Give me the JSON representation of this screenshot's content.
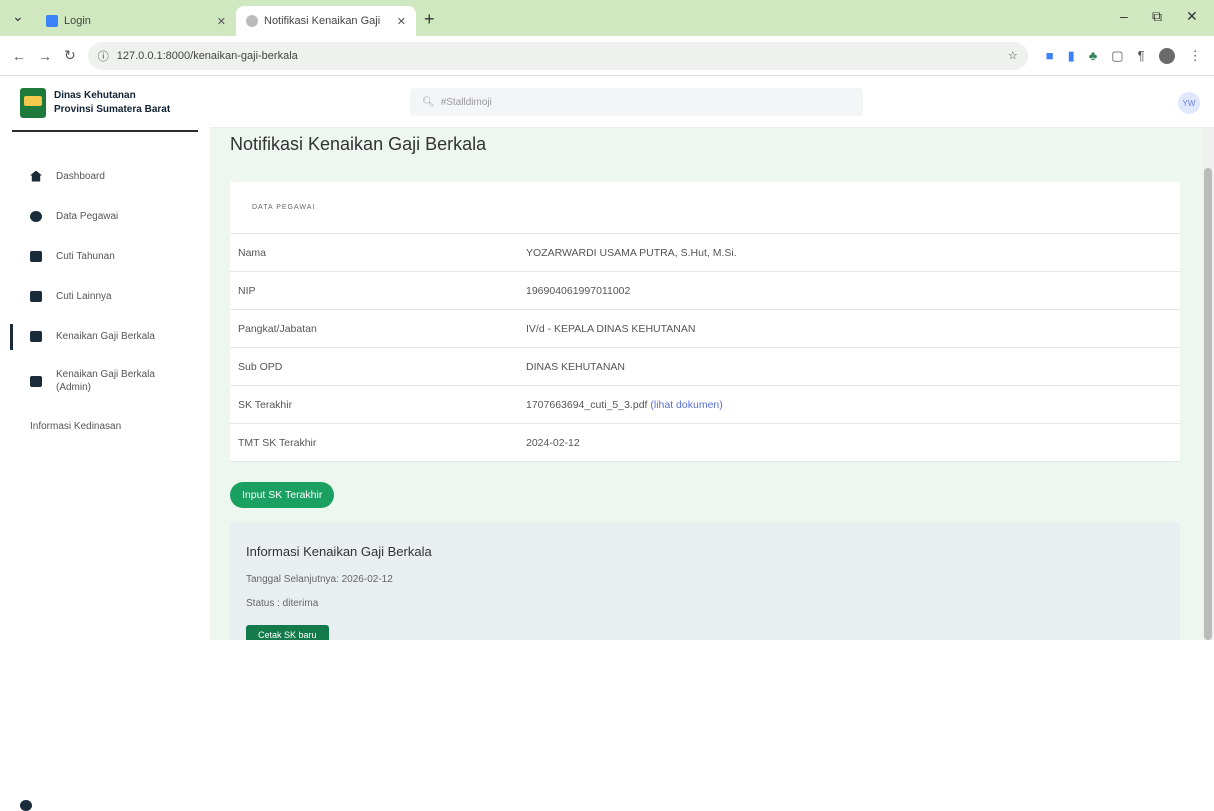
{
  "browser": {
    "tabs": [
      {
        "title": "Login",
        "active": false
      },
      {
        "title": "Notifikasi Kenaikan Gaji Berkala",
        "active": true
      }
    ],
    "new_tab": "+",
    "address": "127.0.0.1:8000/kenaikan-gaji-berkala",
    "controls": {
      "minimize": "–",
      "maximize": "⧉",
      "close": "✕"
    }
  },
  "brand": {
    "line1": "Dinas Kehutanan",
    "line2": "Provinsi Sumatera Barat"
  },
  "sidebar": {
    "items": [
      {
        "label": "Dashboard",
        "icon": "home-icon"
      },
      {
        "label": "Data Pegawai",
        "icon": "users-icon"
      },
      {
        "label": "Cuti Tahunan",
        "icon": "folder-icon"
      },
      {
        "label": "Cuti Lainnya",
        "icon": "folder-icon"
      },
      {
        "label": "Kenaikan Gaji Berkala",
        "icon": "card-icon",
        "active": true
      },
      {
        "label": "Kenaikan Gaji Berkala (Admin)",
        "icon": "card-icon"
      },
      {
        "label": "Informasi Kedinasan",
        "icon": "info-icon"
      }
    ]
  },
  "topbar": {
    "search_placeholder": "#Stalldimoji",
    "user_initials": "YW"
  },
  "page": {
    "title": "Notifikasi Kenaikan Gaji Berkala",
    "card_header": "DATA PEGAWAI",
    "rows": [
      {
        "key": "Nama",
        "value": "YOZARWARDI USAMA PUTRA, S.Hut, M.Si."
      },
      {
        "key": "NIP",
        "value": "196904061997011002"
      },
      {
        "key": "Pangkat/Jabatan",
        "value": "IV/d - KEPALA DINAS KEHUTANAN"
      },
      {
        "key": "Sub OPD",
        "value": "DINAS KEHUTANAN"
      },
      {
        "key": "SK Terakhir",
        "value": "1707663694_cuti_5_3.pdf",
        "link": "(lihat dokumen)"
      },
      {
        "key": "TMT SK Terakhir",
        "value": "2024-02-12"
      }
    ],
    "input_button": "Input SK Terakhir",
    "info": {
      "title": "Informasi Kenaikan Gaji Berkala",
      "next_date": "Tanggal Selanjutnya: 2026-02-12",
      "status": "Status : diterima",
      "button": "Cetak SK baru"
    }
  }
}
